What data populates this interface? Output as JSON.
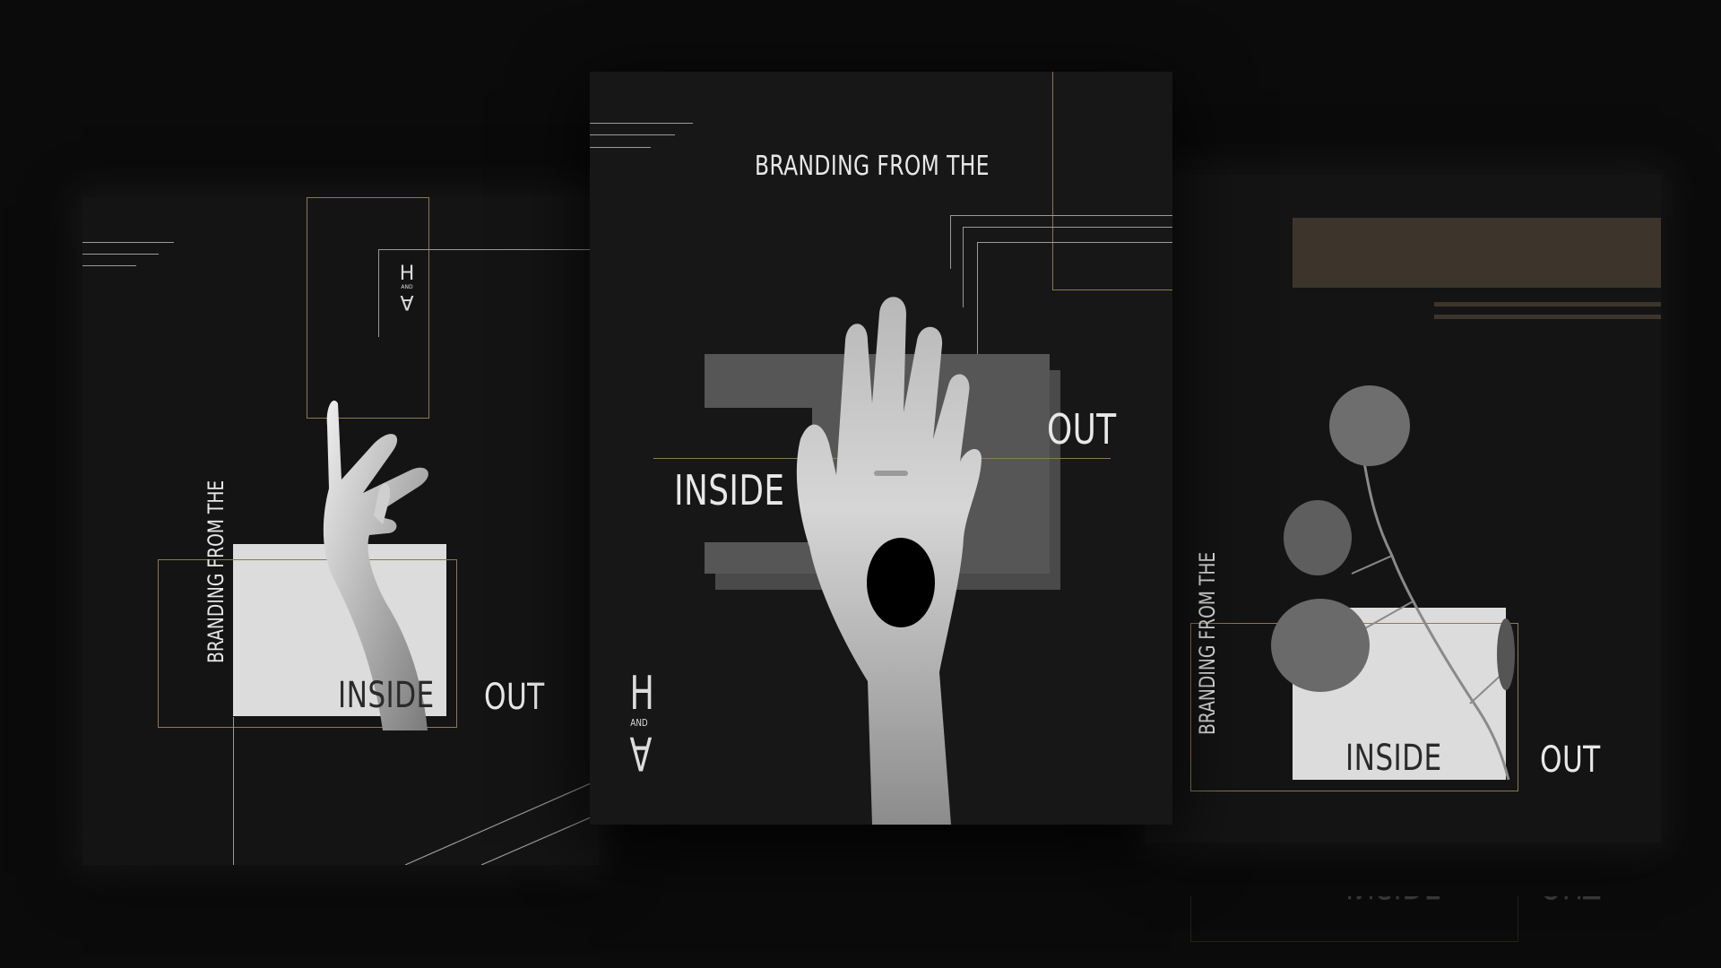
{
  "brand": {
    "tagline": "BRANDING FROM THE",
    "inside": "INSIDE",
    "out": "OUT",
    "logo_top": "H",
    "logo_mid": "AND",
    "logo_bottom": "A"
  },
  "colors": {
    "background": "#0b0b0b",
    "card": "#141414",
    "gold": "#8a7a55",
    "brown_bar": "#3d352c",
    "light_box": "#dcdcdc",
    "gray_box": "#4a4a4a"
  },
  "images": {
    "left": "hand-reaching-photo",
    "center": "hand-with-hole-photo",
    "right": "eucalyptus-branch-photo"
  }
}
